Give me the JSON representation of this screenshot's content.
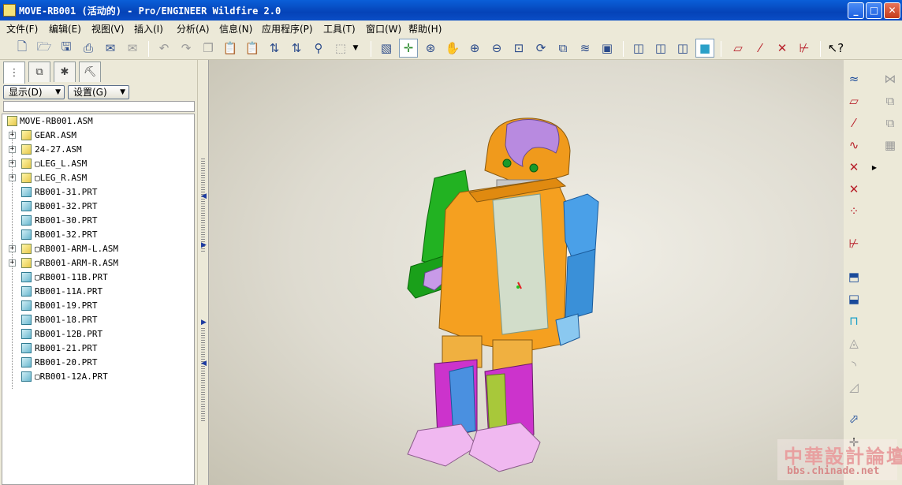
{
  "window": {
    "title": "MOVE-RB001 (活动的) - Pro/ENGINEER Wildfire 2.0",
    "minimize_label": "_",
    "maximize_label": "□",
    "close_label": "✕"
  },
  "menu": {
    "items": [
      {
        "label": "文件(F)"
      },
      {
        "label": "编辑(E)"
      },
      {
        "label": "视图(V)"
      },
      {
        "label": "插入(I)"
      },
      {
        "label": "分析(A)"
      },
      {
        "label": "信息(N)"
      },
      {
        "label": "应用程序(P)"
      },
      {
        "label": "工具(T)"
      },
      {
        "label": "窗口(W)"
      },
      {
        "label": "帮助(H)"
      }
    ]
  },
  "toolbar": {
    "icons": [
      "new-file-icon",
      "open-folder-icon",
      "save-icon",
      "print-icon",
      "send-mail-icon",
      "mail-icon",
      "undo-icon",
      "redo-icon",
      "copy-icon",
      "paste-icon",
      "paste-special-icon",
      "regenerate-icon",
      "regenerate-manager-icon",
      "find-icon",
      "select-box-icon",
      "select-dropdown-icon",
      "redraw-icon",
      "spin-center-icon",
      "orient-icon",
      "pan-icon",
      "zoom-in-icon",
      "zoom-out-icon",
      "refit-icon",
      "reorient-icon",
      "saved-views-icon",
      "layers-icon",
      "view-manager-icon",
      "wireframe-icon",
      "hidden-line-icon",
      "no-hidden-icon",
      "shading-icon",
      "datum-planes-icon",
      "datum-axes-icon",
      "datum-points-icon",
      "coord-sys-icon",
      "whats-this-icon"
    ]
  },
  "model_tree": {
    "view_tabs": [
      "model-tree-tab",
      "layers-tab",
      "favorites-tab",
      "connections-tab"
    ],
    "show_label": "显示(D)",
    "settings_label": "设置(G)",
    "root": "MOVE-RB001.ASM",
    "items": [
      {
        "label": "GEAR.ASM",
        "type": "asm",
        "expandable": true
      },
      {
        "label": "24-27.ASM",
        "type": "asm",
        "expandable": true
      },
      {
        "label": "▢LEG_L.ASM",
        "type": "asm",
        "expandable": true
      },
      {
        "label": "▢LEG_R.ASM",
        "type": "asm",
        "expandable": true
      },
      {
        "label": "RB001-31.PRT",
        "type": "prt",
        "expandable": false
      },
      {
        "label": "RB001-32.PRT",
        "type": "prt",
        "expandable": false
      },
      {
        "label": "RB001-30.PRT",
        "type": "prt",
        "expandable": false
      },
      {
        "label": "RB001-32.PRT",
        "type": "prt",
        "expandable": false
      },
      {
        "label": "▢RB001-ARM-L.ASM",
        "type": "asm",
        "expandable": true
      },
      {
        "label": "▢RB001-ARM-R.ASM",
        "type": "asm",
        "expandable": true
      },
      {
        "label": "▢RB001-11B.PRT",
        "type": "prt",
        "expandable": false
      },
      {
        "label": "RB001-11A.PRT",
        "type": "prt",
        "expandable": false
      },
      {
        "label": "RB001-19.PRT",
        "type": "prt",
        "expandable": false
      },
      {
        "label": "RB001-18.PRT",
        "type": "prt",
        "expandable": false
      },
      {
        "label": "RB001-12B.PRT",
        "type": "prt",
        "expandable": false
      },
      {
        "label": "RB001-21.PRT",
        "type": "prt",
        "expandable": false
      },
      {
        "label": "RB001-20.PRT",
        "type": "prt",
        "expandable": false
      },
      {
        "label": "▢RB001-12A.PRT",
        "type": "prt",
        "expandable": false
      }
    ]
  },
  "right_toolbar": {
    "icons": [
      "datum-curve-sketch-icon",
      "datum-plane-icon",
      "datum-axis-icon",
      "datum-curve-icon",
      "datum-point-icon",
      "datum-point-offset-icon",
      "datum-point-field-icon",
      "coordinate-system-icon",
      "assemble-component-icon",
      "create-component-icon",
      "hole-icon",
      "cut-icon",
      "round-icon",
      "chamfer-icon",
      "pattern-icon",
      "mirror-icon",
      "move-icon",
      "merge-icon",
      "repeat-icon"
    ]
  },
  "watermark": {
    "brand": "中華設計論壇",
    "url": "bbs.chinade.net"
  }
}
